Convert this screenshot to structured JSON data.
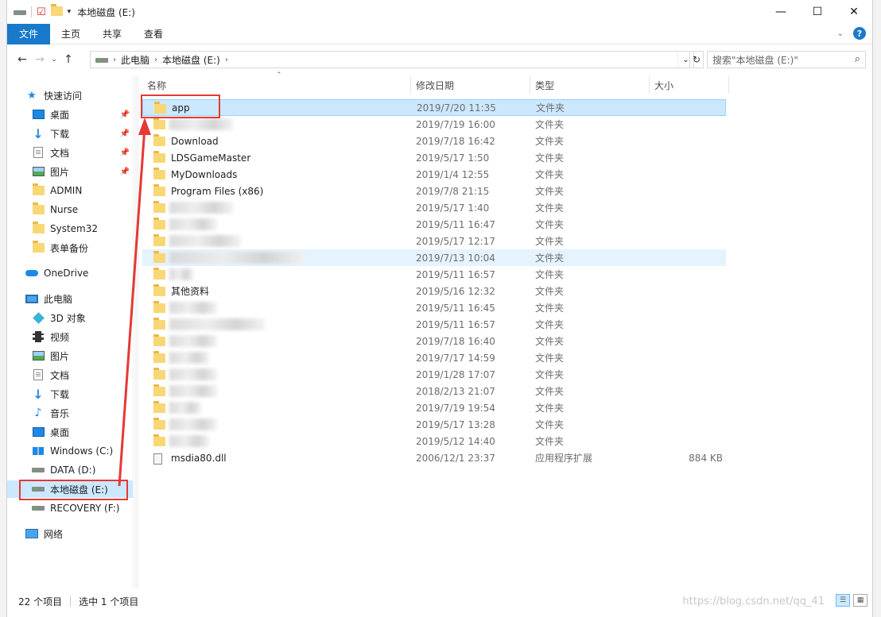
{
  "window": {
    "title": "本地磁盘 (E:)"
  },
  "ribbon": {
    "tabs": [
      "文件",
      "主页",
      "共享",
      "查看"
    ]
  },
  "address": {
    "crumbs": [
      "此电脑",
      "本地磁盘 (E:)"
    ],
    "search_placeholder": "搜索\"本地磁盘 (E:)\""
  },
  "nav": {
    "items": [
      {
        "label": "快速访问",
        "icon": "star-icon"
      },
      {
        "label": "桌面",
        "icon": "desktop-icon",
        "pinned": true
      },
      {
        "label": "下载",
        "icon": "download-icon",
        "pinned": true
      },
      {
        "label": "文档",
        "icon": "document-icon",
        "pinned": true
      },
      {
        "label": "图片",
        "icon": "picture-icon",
        "pinned": true
      },
      {
        "label": "ADMIN",
        "icon": "folder-icon"
      },
      {
        "label": "Nurse",
        "icon": "folder-icon"
      },
      {
        "label": "System32",
        "icon": "folder-icon"
      },
      {
        "label": "表单备份",
        "icon": "folder-icon"
      },
      {
        "label": "OneDrive",
        "icon": "cloud-icon"
      },
      {
        "label": "此电脑",
        "icon": "computer-icon"
      },
      {
        "label": "3D 对象",
        "icon": "cube-icon"
      },
      {
        "label": "视频",
        "icon": "video-icon"
      },
      {
        "label": "图片",
        "icon": "picture-icon"
      },
      {
        "label": "文档",
        "icon": "document-icon"
      },
      {
        "label": "下载",
        "icon": "download-icon"
      },
      {
        "label": "音乐",
        "icon": "music-icon"
      },
      {
        "label": "桌面",
        "icon": "desktop-icon"
      },
      {
        "label": "Windows (C:)",
        "icon": "windows-drive-icon"
      },
      {
        "label": "DATA (D:)",
        "icon": "drive-icon"
      },
      {
        "label": "本地磁盘 (E:)",
        "icon": "drive-icon",
        "selected": true
      },
      {
        "label": "RECOVERY (F:)",
        "icon": "drive-icon"
      },
      {
        "label": "网络",
        "icon": "network-icon"
      }
    ]
  },
  "columns": [
    "名称",
    "修改日期",
    "类型",
    "大小"
  ],
  "files": [
    {
      "name": "app",
      "date": "2019/7/20 11:35",
      "type": "文件夹",
      "size": "",
      "selected": true
    },
    {
      "name": "",
      "date": "2019/7/19 16:00",
      "type": "文件夹",
      "size": ""
    },
    {
      "name": "Download",
      "date": "2019/7/18 16:42",
      "type": "文件夹",
      "size": ""
    },
    {
      "name": "LDSGameMaster",
      "date": "2019/5/17 1:50",
      "type": "文件夹",
      "size": ""
    },
    {
      "name": "MyDownloads",
      "date": "2019/1/4 12:55",
      "type": "文件夹",
      "size": ""
    },
    {
      "name": "Program Files (x86)",
      "date": "2019/7/8 21:15",
      "type": "文件夹",
      "size": ""
    },
    {
      "name": "",
      "date": "2019/5/17 1:40",
      "type": "文件夹",
      "size": ""
    },
    {
      "name": "",
      "date": "2019/5/11 16:47",
      "type": "文件夹",
      "size": ""
    },
    {
      "name": "",
      "date": "2019/5/17 12:17",
      "type": "文件夹",
      "size": ""
    },
    {
      "name": "",
      "date": "2019/7/13 10:04",
      "type": "文件夹",
      "size": "",
      "hover": true
    },
    {
      "name": "",
      "date": "2019/5/11 16:57",
      "type": "文件夹",
      "size": ""
    },
    {
      "name": "其他资料",
      "date": "2019/5/16 12:32",
      "type": "文件夹",
      "size": ""
    },
    {
      "name": "",
      "date": "2019/5/11 16:45",
      "type": "文件夹",
      "size": ""
    },
    {
      "name": "",
      "date": "2019/5/11 16:57",
      "type": "文件夹",
      "size": ""
    },
    {
      "name": "",
      "date": "2019/7/18 16:40",
      "type": "文件夹",
      "size": ""
    },
    {
      "name": "",
      "date": "2019/7/17 14:59",
      "type": "文件夹",
      "size": ""
    },
    {
      "name": "",
      "date": "2019/1/28 17:07",
      "type": "文件夹",
      "size": ""
    },
    {
      "name": "",
      "date": "2018/2/13 21:07",
      "type": "文件夹",
      "size": ""
    },
    {
      "name": "",
      "date": "2019/7/19 19:54",
      "type": "文件夹",
      "size": ""
    },
    {
      "name": "",
      "date": "2019/5/17 13:28",
      "type": "文件夹",
      "size": ""
    },
    {
      "name": "",
      "date": "2019/5/12 14:40",
      "type": "文件夹",
      "size": ""
    },
    {
      "name": "msdia80.dll",
      "date": "2006/12/1 23:37",
      "type": "应用程序扩展",
      "size": "884 KB",
      "file": true
    }
  ],
  "status": {
    "count": "22 个项目",
    "selection": "选中 1 个项目"
  },
  "watermark": "https://blog.csdn.net/qq_41",
  "colors": {
    "accent": "#1979ca",
    "selection": "#cce8ff",
    "highlight": "#e53935"
  }
}
